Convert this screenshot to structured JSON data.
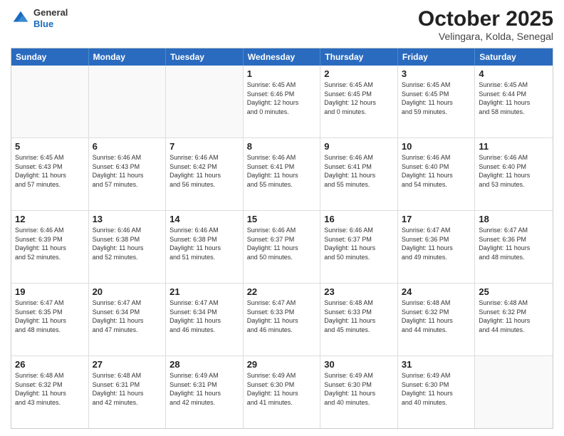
{
  "header": {
    "logo_line1": "General",
    "logo_line2": "Blue",
    "month": "October 2025",
    "location": "Velingara, Kolda, Senegal"
  },
  "day_headers": [
    "Sunday",
    "Monday",
    "Tuesday",
    "Wednesday",
    "Thursday",
    "Friday",
    "Saturday"
  ],
  "weeks": [
    [
      {
        "day": "",
        "info": ""
      },
      {
        "day": "",
        "info": ""
      },
      {
        "day": "",
        "info": ""
      },
      {
        "day": "1",
        "info": "Sunrise: 6:45 AM\nSunset: 6:46 PM\nDaylight: 12 hours\nand 0 minutes."
      },
      {
        "day": "2",
        "info": "Sunrise: 6:45 AM\nSunset: 6:45 PM\nDaylight: 12 hours\nand 0 minutes."
      },
      {
        "day": "3",
        "info": "Sunrise: 6:45 AM\nSunset: 6:45 PM\nDaylight: 11 hours\nand 59 minutes."
      },
      {
        "day": "4",
        "info": "Sunrise: 6:45 AM\nSunset: 6:44 PM\nDaylight: 11 hours\nand 58 minutes."
      }
    ],
    [
      {
        "day": "5",
        "info": "Sunrise: 6:45 AM\nSunset: 6:43 PM\nDaylight: 11 hours\nand 57 minutes."
      },
      {
        "day": "6",
        "info": "Sunrise: 6:46 AM\nSunset: 6:43 PM\nDaylight: 11 hours\nand 57 minutes."
      },
      {
        "day": "7",
        "info": "Sunrise: 6:46 AM\nSunset: 6:42 PM\nDaylight: 11 hours\nand 56 minutes."
      },
      {
        "day": "8",
        "info": "Sunrise: 6:46 AM\nSunset: 6:41 PM\nDaylight: 11 hours\nand 55 minutes."
      },
      {
        "day": "9",
        "info": "Sunrise: 6:46 AM\nSunset: 6:41 PM\nDaylight: 11 hours\nand 55 minutes."
      },
      {
        "day": "10",
        "info": "Sunrise: 6:46 AM\nSunset: 6:40 PM\nDaylight: 11 hours\nand 54 minutes."
      },
      {
        "day": "11",
        "info": "Sunrise: 6:46 AM\nSunset: 6:40 PM\nDaylight: 11 hours\nand 53 minutes."
      }
    ],
    [
      {
        "day": "12",
        "info": "Sunrise: 6:46 AM\nSunset: 6:39 PM\nDaylight: 11 hours\nand 52 minutes."
      },
      {
        "day": "13",
        "info": "Sunrise: 6:46 AM\nSunset: 6:38 PM\nDaylight: 11 hours\nand 52 minutes."
      },
      {
        "day": "14",
        "info": "Sunrise: 6:46 AM\nSunset: 6:38 PM\nDaylight: 11 hours\nand 51 minutes."
      },
      {
        "day": "15",
        "info": "Sunrise: 6:46 AM\nSunset: 6:37 PM\nDaylight: 11 hours\nand 50 minutes."
      },
      {
        "day": "16",
        "info": "Sunrise: 6:46 AM\nSunset: 6:37 PM\nDaylight: 11 hours\nand 50 minutes."
      },
      {
        "day": "17",
        "info": "Sunrise: 6:47 AM\nSunset: 6:36 PM\nDaylight: 11 hours\nand 49 minutes."
      },
      {
        "day": "18",
        "info": "Sunrise: 6:47 AM\nSunset: 6:36 PM\nDaylight: 11 hours\nand 48 minutes."
      }
    ],
    [
      {
        "day": "19",
        "info": "Sunrise: 6:47 AM\nSunset: 6:35 PM\nDaylight: 11 hours\nand 48 minutes."
      },
      {
        "day": "20",
        "info": "Sunrise: 6:47 AM\nSunset: 6:34 PM\nDaylight: 11 hours\nand 47 minutes."
      },
      {
        "day": "21",
        "info": "Sunrise: 6:47 AM\nSunset: 6:34 PM\nDaylight: 11 hours\nand 46 minutes."
      },
      {
        "day": "22",
        "info": "Sunrise: 6:47 AM\nSunset: 6:33 PM\nDaylight: 11 hours\nand 46 minutes."
      },
      {
        "day": "23",
        "info": "Sunrise: 6:48 AM\nSunset: 6:33 PM\nDaylight: 11 hours\nand 45 minutes."
      },
      {
        "day": "24",
        "info": "Sunrise: 6:48 AM\nSunset: 6:32 PM\nDaylight: 11 hours\nand 44 minutes."
      },
      {
        "day": "25",
        "info": "Sunrise: 6:48 AM\nSunset: 6:32 PM\nDaylight: 11 hours\nand 44 minutes."
      }
    ],
    [
      {
        "day": "26",
        "info": "Sunrise: 6:48 AM\nSunset: 6:32 PM\nDaylight: 11 hours\nand 43 minutes."
      },
      {
        "day": "27",
        "info": "Sunrise: 6:48 AM\nSunset: 6:31 PM\nDaylight: 11 hours\nand 42 minutes."
      },
      {
        "day": "28",
        "info": "Sunrise: 6:49 AM\nSunset: 6:31 PM\nDaylight: 11 hours\nand 42 minutes."
      },
      {
        "day": "29",
        "info": "Sunrise: 6:49 AM\nSunset: 6:30 PM\nDaylight: 11 hours\nand 41 minutes."
      },
      {
        "day": "30",
        "info": "Sunrise: 6:49 AM\nSunset: 6:30 PM\nDaylight: 11 hours\nand 40 minutes."
      },
      {
        "day": "31",
        "info": "Sunrise: 6:49 AM\nSunset: 6:30 PM\nDaylight: 11 hours\nand 40 minutes."
      },
      {
        "day": "",
        "info": ""
      }
    ]
  ]
}
